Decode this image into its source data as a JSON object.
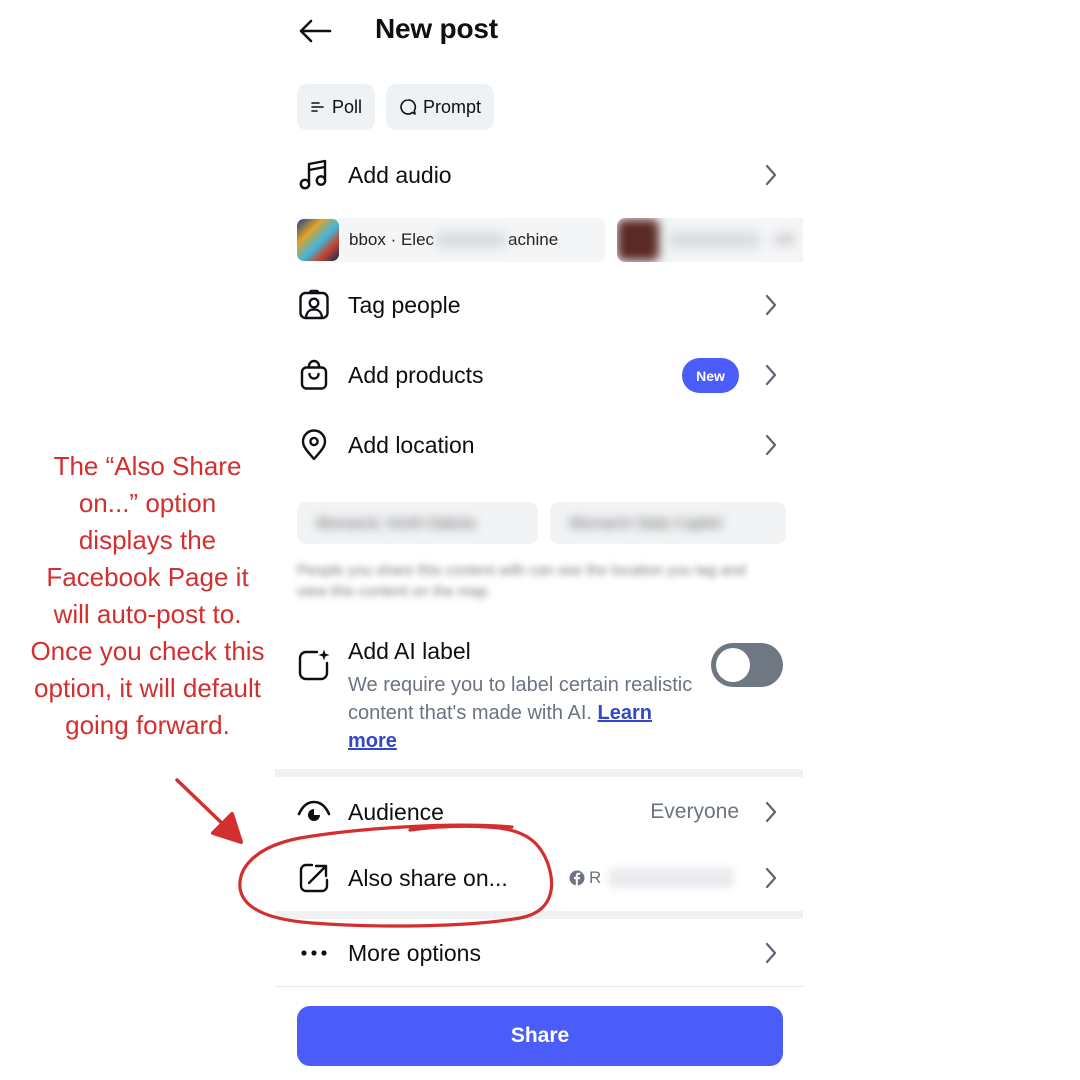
{
  "header": {
    "title": "New post"
  },
  "chips": [
    {
      "label": "Poll",
      "icon": "poll-icon"
    },
    {
      "label": "Prompt",
      "icon": "prompt-icon"
    }
  ],
  "audio": {
    "label": "Add audio",
    "suggestions": [
      {
        "text_visible": "bbox · Elec",
        "text_tail": "achine"
      },
      {
        "text_visible": "· All"
      }
    ]
  },
  "rows": {
    "tag_people": "Tag people",
    "add_products": "Add products",
    "add_products_badge": "New",
    "add_location": "Add location"
  },
  "location_suggestions": [
    "Bismarck, North Dakota",
    "Bismarck State Capitol"
  ],
  "location_note": "People you share this content with can see the location you tag and view this content on the map.",
  "ai_label": {
    "title": "Add AI label",
    "description": "We require you to label certain realistic content that's made with AI.",
    "link": "Learn more",
    "toggle_on": false
  },
  "audience": {
    "label": "Audience",
    "value": "Everyone"
  },
  "also_share": {
    "label": "Also share on...",
    "destination_initial": "R"
  },
  "more_options": {
    "label": "More options"
  },
  "share_button": {
    "label": "Share"
  },
  "annotation": {
    "text": "The “Also Share on...” option displays the Facebook Page it will auto-post to. Once you check this option, it will default going forward.",
    "color": "#d32f2f"
  },
  "colors": {
    "accent": "#4a5df9",
    "secondary_text": "#6b7480",
    "toggle_off": "#6f7782"
  }
}
